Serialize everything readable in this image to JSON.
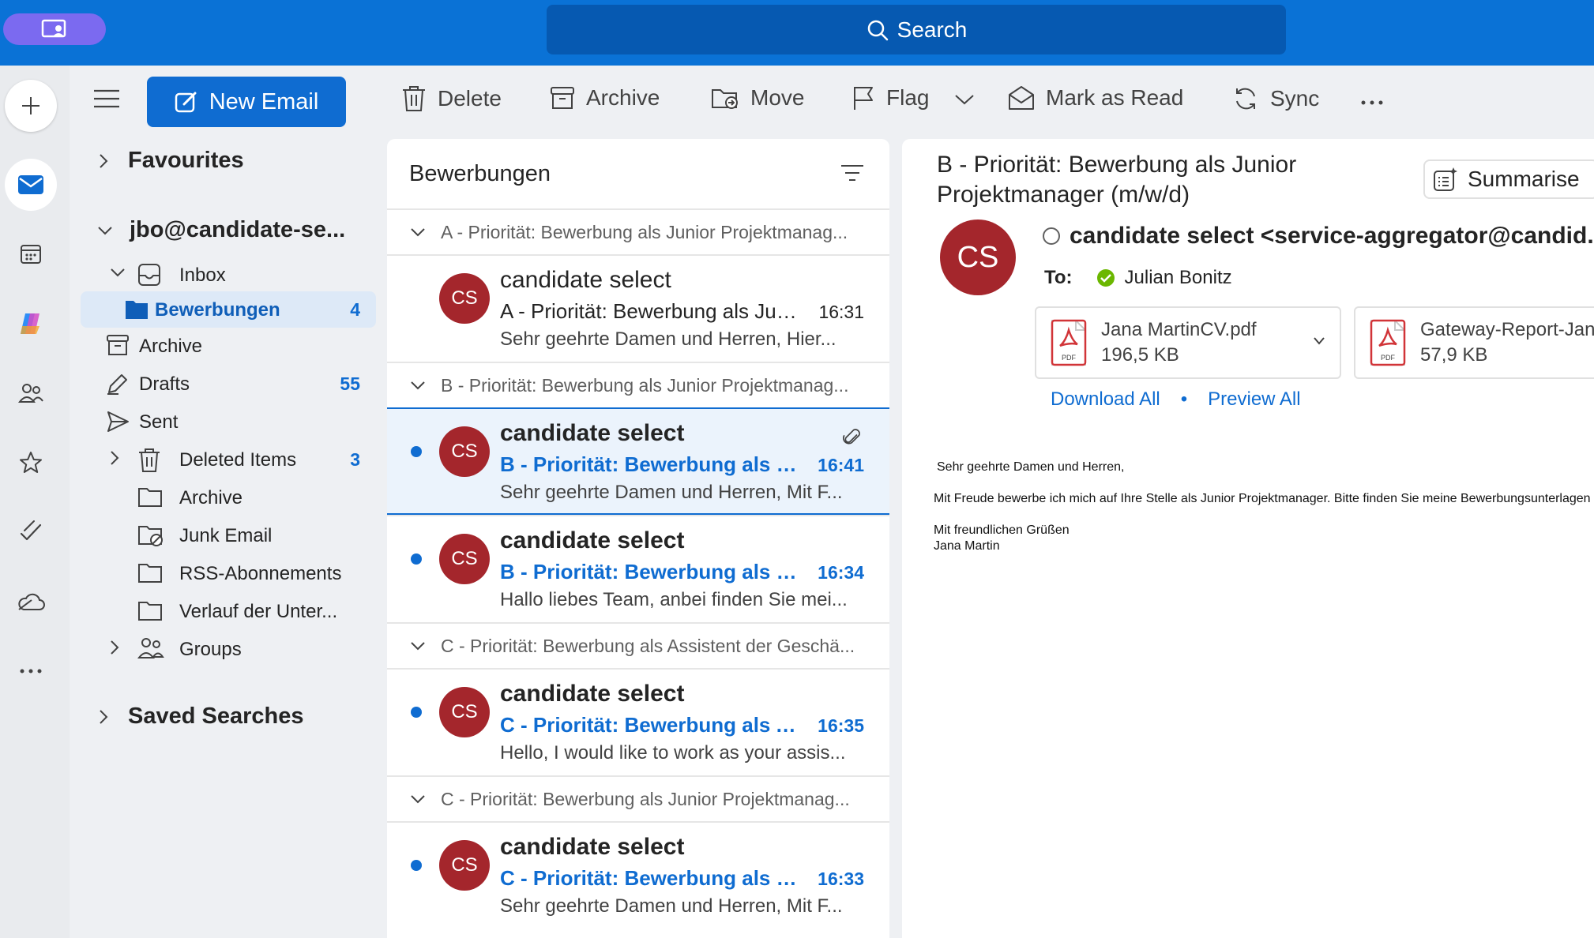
{
  "top": {
    "search_label": "Search"
  },
  "rail": {
    "icons": [
      "plus-icon",
      "mail-icon",
      "calendar-icon",
      "copilot-icon",
      "people-icon",
      "star-icon",
      "todo-icon",
      "cloud-icon",
      "more-icon"
    ]
  },
  "toolbar": {
    "new_email": "New Email",
    "delete": "Delete",
    "archive": "Archive",
    "move": "Move",
    "flag": "Flag",
    "mark_read": "Mark as Read",
    "sync": "Sync"
  },
  "folders": {
    "favourites": "Favourites",
    "account": "jbo@candidate-se...",
    "inbox": "Inbox",
    "bewerbungen": {
      "label": "Bewerbungen",
      "count": "4"
    },
    "archive": "Archive",
    "drafts": {
      "label": "Drafts",
      "count": "55"
    },
    "sent": "Sent",
    "deleted": {
      "label": "Deleted Items",
      "count": "3"
    },
    "archive2": "Archive",
    "junk": "Junk Email",
    "rss": "RSS-Abonnements",
    "verlauf": "Verlauf der Unter...",
    "groups": "Groups",
    "saved_searches": "Saved Searches"
  },
  "list": {
    "title": "Bewerbungen",
    "groups": [
      "A - Priorität: Bewerbung als Junior Projektmanag...",
      "B - Priorität: Bewerbung als Junior Projektmanag...",
      "C - Priorität: Bewerbung als Assistent der Geschä...",
      "C - Priorität: Bewerbung als Junior Projektmanag..."
    ],
    "messages": [
      {
        "initials": "CS",
        "sender": "candidate select",
        "subject": "A - Priorität: Bewerbung als Junior Projektmanager (m/w/d)",
        "time": "16:31",
        "preview": "Sehr geehrte Damen und Herren, Hier..."
      },
      {
        "initials": "CS",
        "sender": "candidate select",
        "subject": "B - Priorität: Bewerbung als Junior Projektmanager (m/w/d)",
        "time": "16:41",
        "preview": "Sehr geehrte Damen und Herren, Mit F..."
      },
      {
        "initials": "CS",
        "sender": "candidate select",
        "subject": "B - Priorität: Bewerbung als Junior Projektmanager (m/w/d)",
        "time": "16:34",
        "preview": "Hallo liebes Team, anbei finden Sie mei..."
      },
      {
        "initials": "CS",
        "sender": "candidate select",
        "subject": "C - Priorität: Bewerbung als Assistent der Geschäftsführung",
        "time": "16:35",
        "preview": "Hello, I would like to work as your assis..."
      },
      {
        "initials": "CS",
        "sender": "candidate select",
        "subject": "C - Priorität: Bewerbung als Junior Projektmanager (m/w/d)",
        "time": "16:33",
        "preview": "Sehr geehrte Damen und Herren, Mit F..."
      }
    ]
  },
  "reading": {
    "subject": "B - Priorität: Bewerbung als Junior Projektmanager (m/w/d)",
    "summarise": "Summarise",
    "initials": "CS",
    "from": "candidate select <service-aggregator@candid...",
    "to_label": "To:",
    "to_name": "Julian Bonitz",
    "attachments": [
      {
        "name": "Jana MartinCV.pdf",
        "size": "196,5 KB",
        "badge": "PDF"
      },
      {
        "name": "Gateway-Report-Jana",
        "size": "57,9 KB",
        "badge": "PDF"
      }
    ],
    "download_all": "Download All",
    "separator": "•",
    "preview_all": "Preview All",
    "body": {
      "greeting": "Sehr geehrte Damen und Herren,",
      "line1": "Mit Freude bewerbe ich mich auf Ihre Stelle als Junior Projektmanager. Bitte finden Sie meine Bewerbungsunterlagen im Anhang.",
      "closing": "Mit freundlichen Grüßen",
      "name": "Jana Martin"
    }
  },
  "colors": {
    "accent": "#0f6cd1",
    "topbar": "#0a72d6",
    "avatar": "#a4262c",
    "pill": "#7b6af0"
  }
}
